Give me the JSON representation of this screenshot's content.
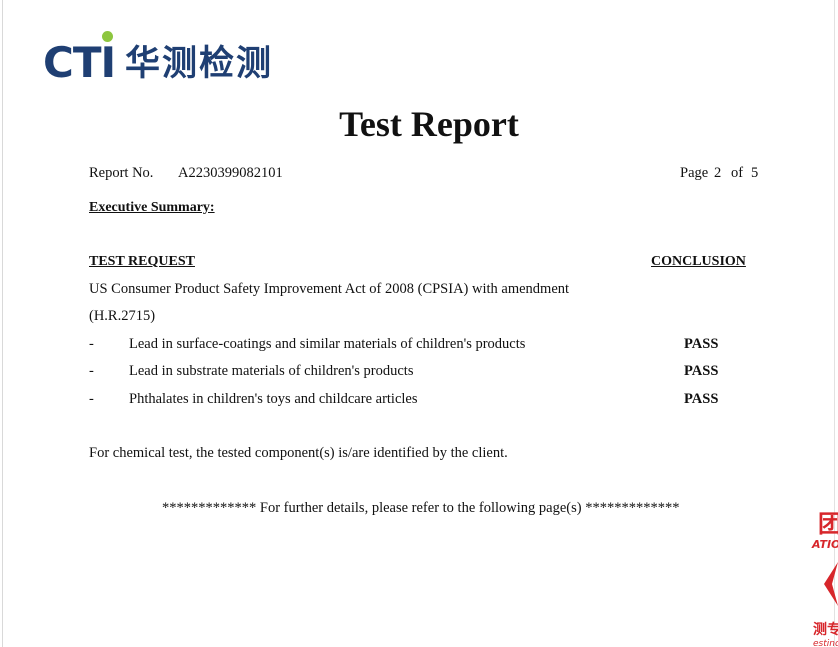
{
  "logo": {
    "latin": "CTI",
    "chinese": "华测检测"
  },
  "title": "Test Report",
  "report": {
    "number_label": "Report No.",
    "number_value": "A2230399082101",
    "page_label": "Page",
    "page_current": "2",
    "page_of": "of",
    "page_total": "5"
  },
  "summary_heading": "Executive Summary:",
  "table": {
    "request_header": "TEST REQUEST",
    "conclusion_header": "CONCLUSION",
    "standard_line1": "US Consumer Product Safety Improvement Act of 2008 (CPSIA) with amendment",
    "standard_line2": "(H.R.2715)",
    "items": [
      {
        "bullet": "-",
        "label": "Lead in surface-coatings and similar materials of children's products",
        "result": "PASS"
      },
      {
        "bullet": "-",
        "label": "Lead in substrate materials of children's products",
        "result": "PASS"
      },
      {
        "bullet": "-",
        "label": "Phthalates in children's toys and childcare articles",
        "result": "PASS"
      }
    ]
  },
  "note": "For chemical test, the tested component(s) is/are identified by the client.",
  "footer_line": "************* For further details, please refer to the following page(s) *************",
  "seal": {
    "color": "#d7262b",
    "chars_top": "团",
    "chars_mid": "ATIO",
    "chars_bottom": "测专",
    "chars_last": "esting"
  }
}
